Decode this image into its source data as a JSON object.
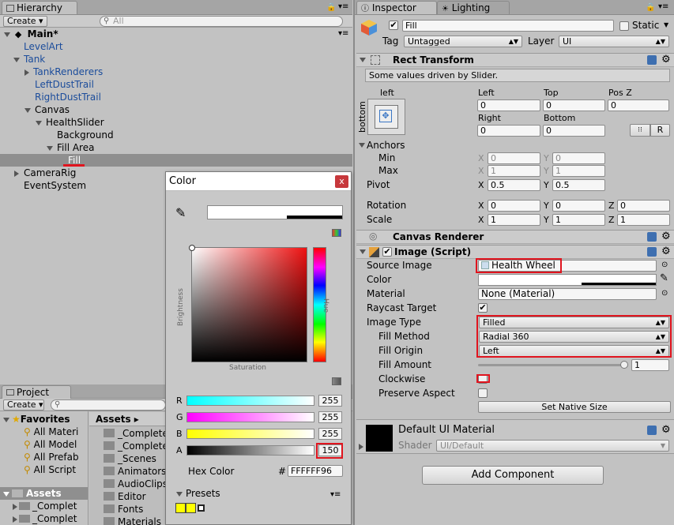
{
  "hierarchy": {
    "tab_label": "Hierarchy",
    "create_label": "Create",
    "search_placeholder": "All",
    "scene_name": "Main*",
    "items": [
      {
        "label": "LevelArt"
      },
      {
        "label": "Tank"
      },
      {
        "label": "TankRenderers"
      },
      {
        "label": "LeftDustTrail"
      },
      {
        "label": "RightDustTrail"
      },
      {
        "label": "Canvas"
      },
      {
        "label": "HealthSlider"
      },
      {
        "label": "Background"
      },
      {
        "label": "Fill Area"
      },
      {
        "label": "Fill"
      },
      {
        "label": "CameraRig"
      },
      {
        "label": "EventSystem"
      }
    ]
  },
  "project": {
    "tab_label": "Project",
    "create_label": "Create",
    "favorites_label": "Favorites",
    "favorites": [
      "All Materi",
      "All Model",
      "All Prefab",
      "All Script"
    ],
    "assets_tree_label": "Assets",
    "assets_tree_children": [
      "_Complet",
      "_Complet"
    ],
    "breadcrumb": "Assets",
    "folders": [
      "_Complete",
      "_Complete",
      "_Scenes",
      "Animators",
      "AudioClips",
      "Editor",
      "Fonts",
      "Materials"
    ]
  },
  "inspector": {
    "tab_label": "Inspector",
    "lighting_tab_label": "Lighting",
    "object_name": "Fill",
    "static_label": "Static",
    "tag_label": "Tag",
    "tag_value": "Untagged",
    "layer_label": "Layer",
    "layer_value": "UI",
    "rect_transform": {
      "title": "Rect Transform",
      "note": "Some values driven by Slider.",
      "anchor_h": "left",
      "anchor_v": "bottom",
      "left_label": "Left",
      "left_value": "0",
      "top_label": "Top",
      "top_value": "0",
      "posz_label": "Pos Z",
      "posz_value": "0",
      "right_label": "Right",
      "right_value": "0",
      "bottom_label": "Bottom",
      "bottom_value": "0",
      "r_button": "R",
      "anchors_label": "Anchors",
      "min_label": "Min",
      "min_x": "0",
      "min_y": "0",
      "max_label": "Max",
      "max_x": "1",
      "max_y": "1",
      "pivot_label": "Pivot",
      "pivot_x": "0.5",
      "pivot_y": "0.5",
      "rotation_label": "Rotation",
      "rot_x": "0",
      "rot_y": "0",
      "rot_z": "0",
      "scale_label": "Scale",
      "scale_x": "1",
      "scale_y": "1",
      "scale_z": "1",
      "x_label": "X",
      "y_label": "Y",
      "z_label": "Z"
    },
    "canvas_renderer": {
      "title": "Canvas Renderer"
    },
    "image_script": {
      "title": "Image (Script)",
      "source_image_label": "Source Image",
      "source_image_value": "Health Wheel",
      "color_label": "Color",
      "material_label": "Material",
      "material_value": "None (Material)",
      "raycast_label": "Raycast Target",
      "image_type_label": "Image Type",
      "image_type_value": "Filled",
      "fill_method_label": "Fill Method",
      "fill_method_value": "Radial 360",
      "fill_origin_label": "Fill Origin",
      "fill_origin_value": "Left",
      "fill_amount_label": "Fill Amount",
      "fill_amount_value": "1",
      "clockwise_label": "Clockwise",
      "preserve_label": "Preserve Aspect",
      "native_size_button": "Set Native Size"
    },
    "material_block": {
      "title": "Default UI Material",
      "shader_label": "Shader",
      "shader_value": "UI/Default"
    },
    "add_component_button": "Add Component"
  },
  "color_picker": {
    "title": "Color",
    "close_glyph": "x",
    "brightness_label": "Brightness",
    "saturation_label": "Saturation",
    "hue_label": "Hue",
    "r_label": "R",
    "r_value": "255",
    "g_label": "G",
    "g_value": "255",
    "b_label": "B",
    "b_value": "255",
    "a_label": "A",
    "a_value": "150",
    "hex_label": "Hex Color",
    "hex_hash": "#",
    "hex_value": "FFFFFF96",
    "presets_label": "Presets"
  },
  "colors": {
    "accent_red": "#e0141e",
    "selection_gray": "#8f8f8f",
    "link_blue": "#1b4c9b"
  }
}
